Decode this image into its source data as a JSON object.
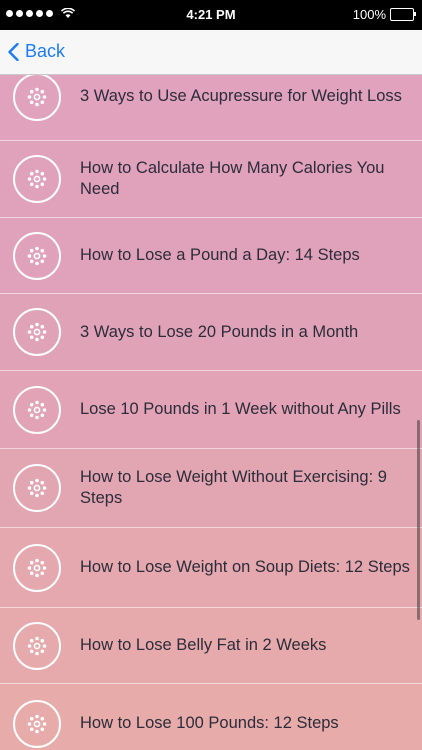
{
  "status": {
    "time": "4:21 PM",
    "battery": "100%"
  },
  "nav": {
    "back_label": "Back"
  },
  "items": [
    {
      "label": "3 Ways to Use Acupressure for Weight Loss",
      "color": "#e1a2bd"
    },
    {
      "label": "How to Calculate How Many Calories You Need",
      "color": "#e0a1bb"
    },
    {
      "label": "How to Lose a Pound a Day: 14 Steps",
      "color": "#e0a2ba"
    },
    {
      "label": "3 Ways to Lose 20 Pounds in a Month",
      "color": "#e0a2b7"
    },
    {
      "label": "Lose 10 Pounds in 1 Week without Any Pills",
      "color": "#e1a3b5"
    },
    {
      "label": "How to Lose Weight Without Exercising: 9 Steps",
      "color": "#e2a5b2"
    },
    {
      "label": "How to Lose Weight on Soup Diets: 12 Steps",
      "color": "#e4a8ae"
    },
    {
      "label": "How to Lose Belly Fat in 2 Weeks",
      "color": "#e6aaac"
    },
    {
      "label": "How to Lose 100 Pounds: 12 Steps",
      "color": "#e7abaa"
    }
  ]
}
